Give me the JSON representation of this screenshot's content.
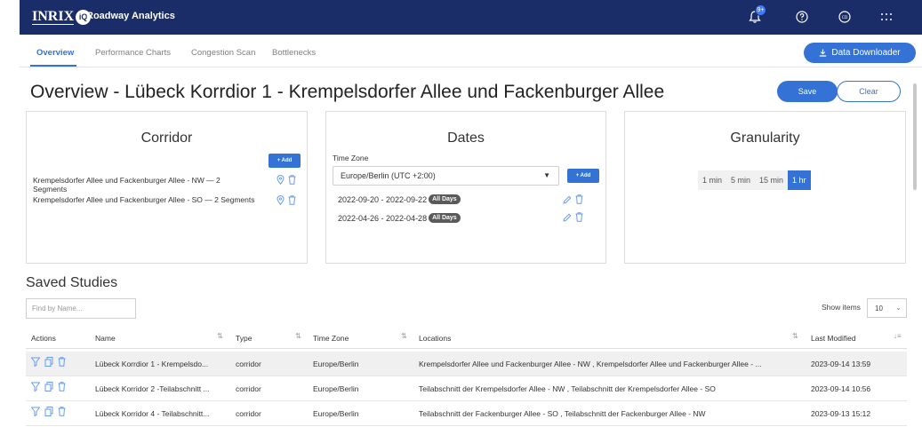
{
  "header": {
    "logo_text": "INRIX",
    "logo_badge": "iQ",
    "app_title": "Roadway Analytics",
    "notification_count": "9+",
    "icons": [
      "notification-bell-icon",
      "help-icon",
      "account-icon",
      "apps-grid-icon"
    ]
  },
  "tabs": [
    {
      "label": "Overview",
      "active": true
    },
    {
      "label": "Performance Charts"
    },
    {
      "label": "Congestion Scan"
    },
    {
      "label": "Bottlenecks"
    }
  ],
  "data_downloader_label": "Data Downloader",
  "page_title": "Overview - Lübeck Korrdior 1 - Krempelsdorfer Allee und Fackenburger Allee",
  "save_label": "Save",
  "clear_label": "Clear",
  "corridor": {
    "title": "Corridor",
    "add_label": "+ Add",
    "items": [
      {
        "line1": "Krempelsdorfer Allee und Fackenburger Allee - NW — 2",
        "line2": "Segments"
      },
      {
        "line1": "Krempelsdorfer Allee und Fackenburger Allee - SO — 2 Segments",
        "line2": ""
      }
    ]
  },
  "dates": {
    "title": "Dates",
    "timezone_label": "Time Zone",
    "timezone_value": "Europe/Berlin (UTC +2:00)",
    "add_label": "+ Add",
    "ranges": [
      {
        "range": "2022-09-20 - 2022-09-22",
        "badge": "All Days"
      },
      {
        "range": "2022-04-26 - 2022-04-28",
        "badge": "All Days"
      }
    ]
  },
  "granularity": {
    "title": "Granularity",
    "options": [
      "1 min",
      "5 min",
      "15 min",
      "1 hr"
    ],
    "selected": "1 hr"
  },
  "saved_studies": {
    "title": "Saved Studies",
    "search_placeholder": "Find by Name...",
    "show_items_label": "Show items",
    "show_items_value": "10",
    "columns": [
      "Actions",
      "Name",
      "Type",
      "Time Zone",
      "Locations",
      "Last Modified"
    ],
    "rows": [
      {
        "name": "Lübeck Korrdior 1 - Krempelsdo...",
        "type": "corridor",
        "tz": "Europe/Berlin",
        "locations": "Krempelsdorfer Allee und Fackenburger Allee - NW , Krempelsdorfer Allee und Fackenburger Allee - ...",
        "modified": "2023-09-14 13:59",
        "highlighted": true
      },
      {
        "name": "Lübeck Korridor 2 -Teilabschnitt ...",
        "type": "corridor",
        "tz": "Europe/Berlin",
        "locations": "Teilabschnitt der Krempelsdorfer Allee - NW , Teilabschnitt der Krempelsdorfer Allee - SO",
        "modified": "2023-09-14 10:56"
      },
      {
        "name": "Lübeck Korridor 4 - Teilabschnitt...",
        "type": "corridor",
        "tz": "Europe/Berlin",
        "locations": "Teilabschnitt der Fackenburger Allee - SO , Teilabschnitt der Fackenburger Allee - NW",
        "modified": "2023-09-13 15:12"
      }
    ]
  }
}
